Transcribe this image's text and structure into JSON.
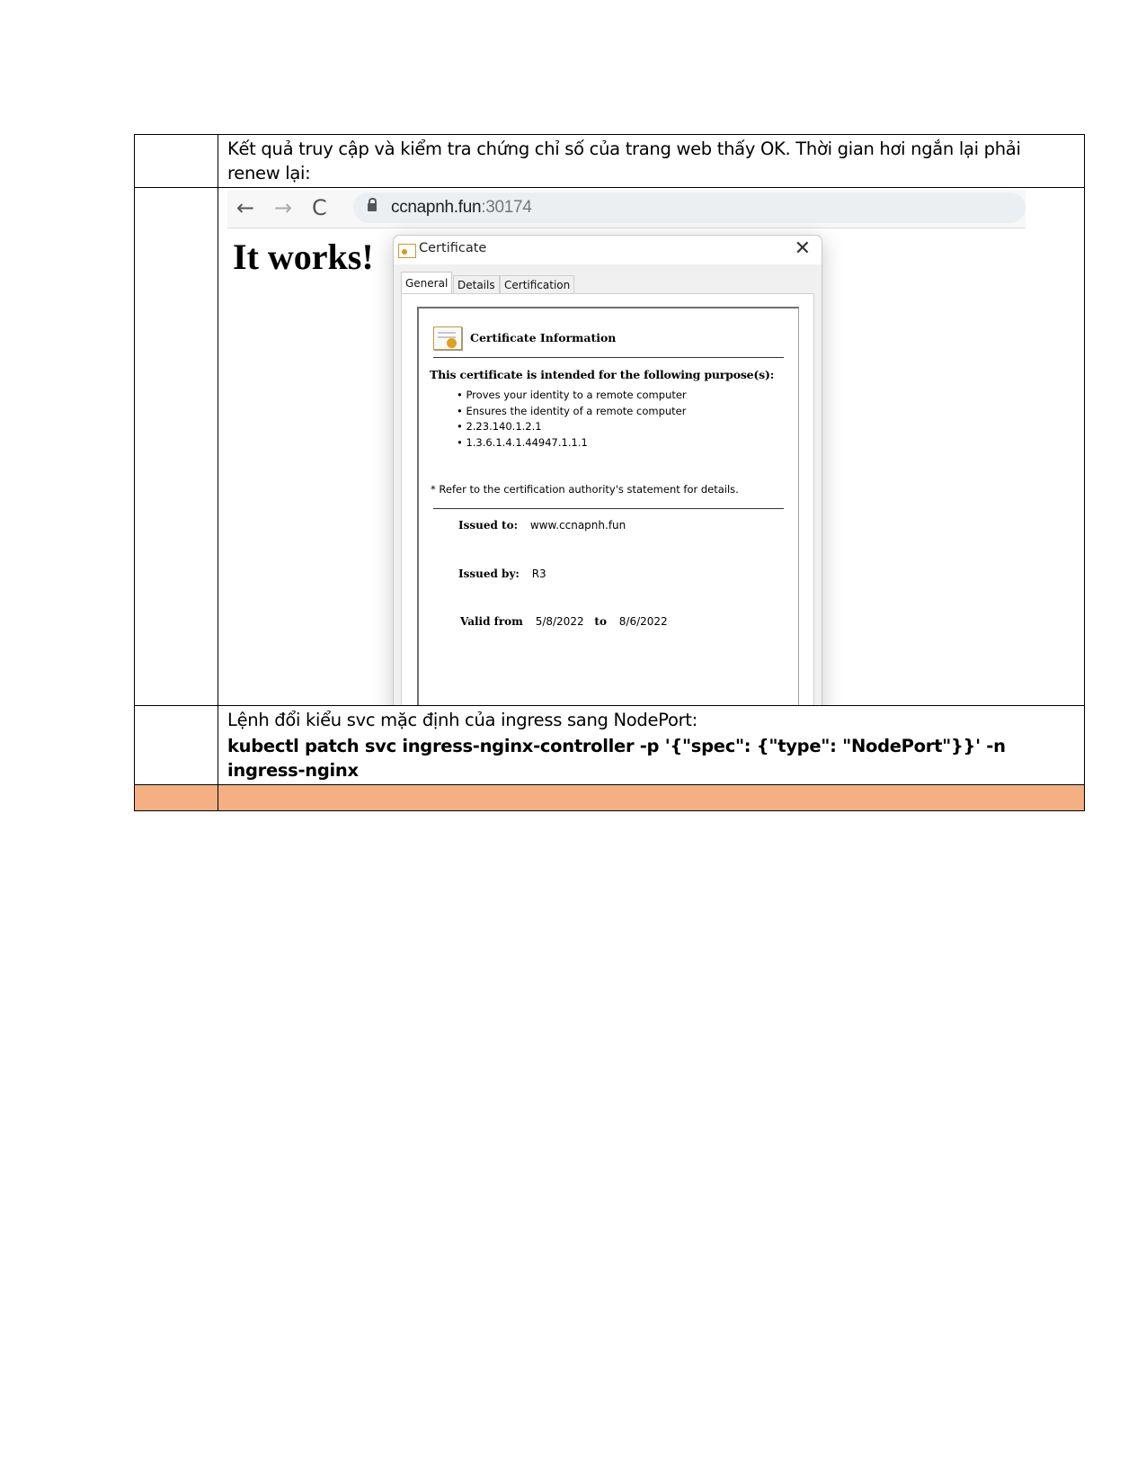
{
  "row1": {
    "text": "Kết quả truy cập và kiểm tra chứng chỉ số của trang web thấy OK. Thời gian hơi ngắn lại phải renew lại:"
  },
  "browser": {
    "back_icon": "←",
    "forward_icon": "→",
    "reload_icon": "C",
    "url_host": "ccnapnh.fun",
    "url_port": ":30174",
    "page_heading": "It works!"
  },
  "dialog": {
    "title": "Certificate",
    "close_glyph": "✕",
    "tabs": [
      "General",
      "Details",
      "Certification Path"
    ],
    "info_title": "Certificate Information",
    "purpose_heading": "This certificate is intended for the following purpose(s):",
    "purposes": [
      "Proves your identity to a remote computer",
      "Ensures the identity of a remote computer",
      "2.23.140.1.2.1",
      "1.3.6.1.4.1.44947.1.1.1"
    ],
    "refer_note": "* Refer to the certification authority's statement for details.",
    "issued_to_label": "Issued to:",
    "issued_to_value": "www.ccnapnh.fun",
    "issued_by_label": "Issued by:",
    "issued_by_value": "R3",
    "valid_from_label": "Valid from",
    "valid_from_value": "5/8/2022",
    "valid_to_label": "to",
    "valid_to_value": "8/6/2022"
  },
  "row3": {
    "text": "Lệnh đổi kiểu svc mặc định của ingress sang NodePort:",
    "command": "kubectl patch svc ingress-nginx-controller -p '{\"spec\": {\"type\": \"NodePort\"}}' -n ingress-nginx"
  },
  "colors": {
    "highlight_row": "#f4b083"
  }
}
